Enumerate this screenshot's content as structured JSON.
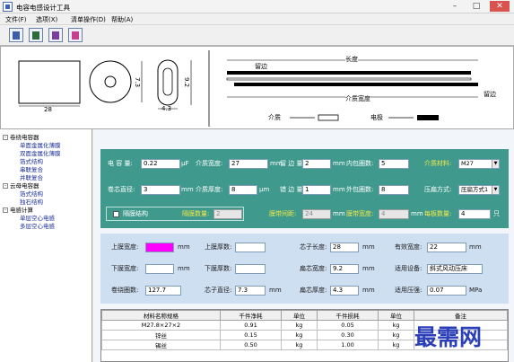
{
  "window": {
    "title": "电容电感设计工具",
    "minimize": "–",
    "maximize": "□",
    "close": "✕"
  },
  "menu": [
    "文件(F)",
    "选项(X)",
    "清单操作(D)",
    "帮助(A)"
  ],
  "toolbar": [
    {
      "icon": "calculator-icon"
    },
    {
      "icon": "save-icon"
    },
    {
      "icon": "export-icon"
    },
    {
      "icon": "tools-icon"
    }
  ],
  "drawing": {
    "rect_width": "28",
    "circle_dim": "7.3",
    "pill_height": "9.2",
    "pill_width": "4.3",
    "length_label": "长度",
    "margin_label_top": "留边",
    "margin_label_right": "留边",
    "dielectric_width_label": "介质宽度",
    "legend_dielectric": "介质",
    "legend_electrode": "电极"
  },
  "tree": [
    {
      "label": "卷绕电容器",
      "level": 0,
      "expanded": true
    },
    {
      "label": "单面金属化薄膜",
      "level": 1
    },
    {
      "label": "双面金属化薄膜",
      "level": 1
    },
    {
      "label": "箔式结构",
      "level": 1
    },
    {
      "label": "串联复合",
      "level": 1
    },
    {
      "label": "并联复合",
      "level": 1
    },
    {
      "label": "云母电容器",
      "level": 0,
      "expanded": true
    },
    {
      "label": "箔式结构",
      "level": 1
    },
    {
      "label": "独石结构",
      "level": 1
    },
    {
      "label": "电感计算",
      "level": 0,
      "expanded": true
    },
    {
      "label": "单层空心电感",
      "level": 1
    },
    {
      "label": "多层空心电感",
      "level": 1
    }
  ],
  "panel1": {
    "capacitance_label": "电 容 量:",
    "capacitance": "0.22",
    "capacitance_unit": "μF",
    "dielectric_width_label": "介质宽度:",
    "dielectric_width": "27",
    "dielectric_width_unit": "mm",
    "margin_label": "留 边 量:",
    "margin": "2",
    "margin_unit": "mm",
    "inner_turns_label": "内包圈数:",
    "inner_turns": "5",
    "dielectric_material_label": "介质材料:",
    "dielectric_material": "M27",
    "core_diameter_label": "卷芯直径:",
    "core_diameter": "3",
    "core_diameter_unit": "mm",
    "dielectric_thickness_label": "介质厚度:",
    "dielectric_thickness": "8",
    "dielectric_thickness_unit": "μm",
    "error_label": "错 边 量:",
    "error": "1",
    "error_unit": "mm",
    "outer_turns_label": "外包圈数:",
    "outer_turns": "8",
    "press_mode_label": "压扁方式:",
    "press_mode": "压扁方式1",
    "partial_structure_label": "隔膜结构",
    "partial_count_label": "隔膜数量:",
    "partial_count": "2",
    "film_width_label": "膜带间距:",
    "film_width": "24",
    "film_width_unit": "mm",
    "film_width2_label": "膜带宽度:",
    "film_width2": "4",
    "film_width2_unit": "mm",
    "ring_turns_label": "每板数量:",
    "ring_turns": "4",
    "ring_turns_unit": "只"
  },
  "panel2": {
    "upper_width_label": "上膜宽度:",
    "upper_width": "",
    "upper_width_unit": "mm",
    "upper_thickness_label": "上膜厚数:",
    "upper_thickness": "",
    "core_length_label": "芯子长度:",
    "core_length": "28",
    "core_length_unit": "mm",
    "effective_width_label": "有效宽度:",
    "effective_width": "22",
    "effective_width_unit": "mm",
    "lower_width_label": "下膜宽度:",
    "lower_width": "",
    "lower_width_unit": "mm",
    "lower_thickness_label": "下膜厚数:",
    "lower_thickness": "",
    "flat_width_label": "扁芯宽度:",
    "flat_width": "9.2",
    "flat_width_unit": "mm",
    "device_label": "适用设备:",
    "device": "斜式风动压床",
    "wound_turns_label": "卷绕圈数:",
    "wound_turns": "127.7",
    "core_diameter2_label": "芯子直径:",
    "core_diameter2": "7.3",
    "core_diameter2_unit": "mm",
    "flat_thickness_label": "扁芯厚度:",
    "flat_thickness": "4.3",
    "flat_thickness_unit": "mm",
    "pressure_label": "适用压强:",
    "pressure": "0.07",
    "pressure_unit": "MPa"
  },
  "table": {
    "headers": [
      "材料名称规格",
      "千件净耗",
      "单位",
      "千件损耗",
      "单位",
      "备注"
    ],
    "rows": [
      [
        "M27.8×27×2",
        "0.91",
        "kg",
        "0.05",
        "kg",
        ""
      ],
      [
        "锌丝",
        "0.15",
        "kg",
        "0.30",
        "kg",
        ""
      ],
      [
        "锡丝",
        "0.50",
        "kg",
        "1.00",
        "kg",
        ""
      ]
    ]
  },
  "watermark": "最需网",
  "colors": {
    "panel_teal": "#3f9a8d",
    "panel_blue": "#cfdff2",
    "tree_blue": "#1c2f9e",
    "magenta_fill": "#ff00ff"
  }
}
